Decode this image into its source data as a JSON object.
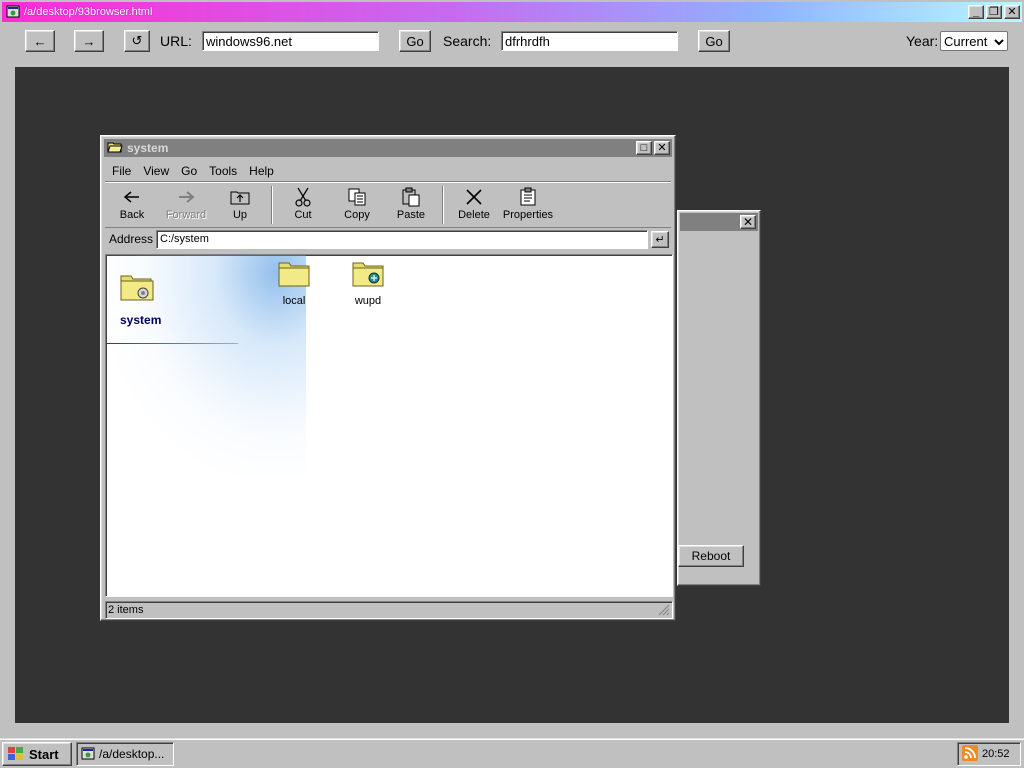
{
  "browser": {
    "title": "/a/desktop/93browser.html",
    "back_label": "←",
    "forward_label": "→",
    "reload_label": "↺",
    "url_label": "URL:",
    "url_value": "windows96.net",
    "go_label": "Go",
    "search_label": "Search:",
    "search_value": "dfrhrdfh",
    "search_go_label": "Go",
    "year_label": "Year:",
    "year_value": "Current",
    "window_buttons": {
      "minimize": "_",
      "restore": "❐",
      "close": "✕"
    }
  },
  "background_window": {
    "close_label": "✕",
    "reboot_label": "Reboot"
  },
  "explorer": {
    "title": "system",
    "window_buttons": {
      "maximize": "□",
      "close": "✕"
    },
    "menu": [
      "File",
      "View",
      "Go",
      "Tools",
      "Help"
    ],
    "toolbar": [
      {
        "label": "Back",
        "icon": "back-arrow-icon",
        "enabled": true
      },
      {
        "label": "Forward",
        "icon": "forward-arrow-icon",
        "enabled": false
      },
      {
        "label": "Up",
        "icon": "up-folder-icon",
        "enabled": true
      },
      {
        "label": "Cut",
        "icon": "scissors-icon",
        "enabled": true
      },
      {
        "label": "Copy",
        "icon": "copy-icon",
        "enabled": true
      },
      {
        "label": "Paste",
        "icon": "paste-icon",
        "enabled": true
      },
      {
        "label": "Delete",
        "icon": "delete-icon",
        "enabled": true
      },
      {
        "label": "Properties",
        "icon": "properties-icon",
        "enabled": true
      }
    ],
    "address_label": "Address",
    "address_value": "C:/system",
    "address_go": "↵",
    "folder_heading": "system",
    "files": [
      {
        "name": "local",
        "icon": "folder-icon"
      },
      {
        "name": "wupd",
        "icon": "system-folder-icon"
      }
    ],
    "status": "2 items"
  },
  "taskbar": {
    "start_label": "Start",
    "task_label": "/a/desktop...",
    "clock": "20:52",
    "tray_icon": "rss-icon"
  },
  "colors": {
    "face": "#c0c0c0",
    "desktop_bg": "#333333",
    "title_gradient_start": "#ff2bd6",
    "title_gradient_end": "#b9f7ff"
  }
}
